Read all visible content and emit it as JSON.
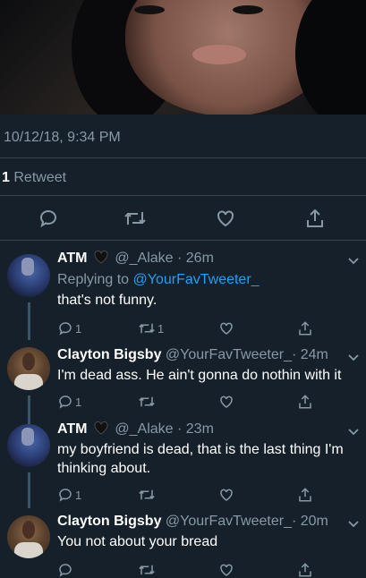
{
  "main_tweet": {
    "timestamp": "10/12/18, 9:34 PM",
    "retweet_count": "1",
    "retweet_label": "Retweet"
  },
  "replies": [
    {
      "name": "ATM",
      "handle": "@_Alake",
      "time": "· 26m",
      "replying_prefix": "Replying to",
      "replying_to": "@YourFavTweeter_",
      "text": "that's not funny.",
      "reply_count": "1",
      "retweet_count": "1",
      "like_count": ""
    },
    {
      "name": "Clayton Bigsby",
      "handle": "@YourFavTweeter_",
      "time": "· 24m",
      "text": "I'm dead ass. He ain't gonna do nothin with it",
      "reply_count": "1",
      "retweet_count": "",
      "like_count": ""
    },
    {
      "name": "ATM",
      "handle": "@_Alake",
      "time": "· 23m",
      "text": "my boyfriend is dead, that is the last thing I'm thinking about.",
      "reply_count": "1",
      "retweet_count": "",
      "like_count": ""
    },
    {
      "name": "Clayton Bigsby",
      "handle": "@YourFavTweeter_",
      "time": "· 20m",
      "text": "You not about your bread",
      "reply_count": "",
      "retweet_count": "",
      "like_count": ""
    }
  ],
  "colors": {
    "background": "#15202b",
    "muted": "#8899a6",
    "link": "#1da1f2",
    "divider": "#38444d"
  },
  "icons": [
    "reply-icon",
    "retweet-icon",
    "like-icon",
    "share-icon",
    "black-heart-icon",
    "chevron-down-icon"
  ]
}
